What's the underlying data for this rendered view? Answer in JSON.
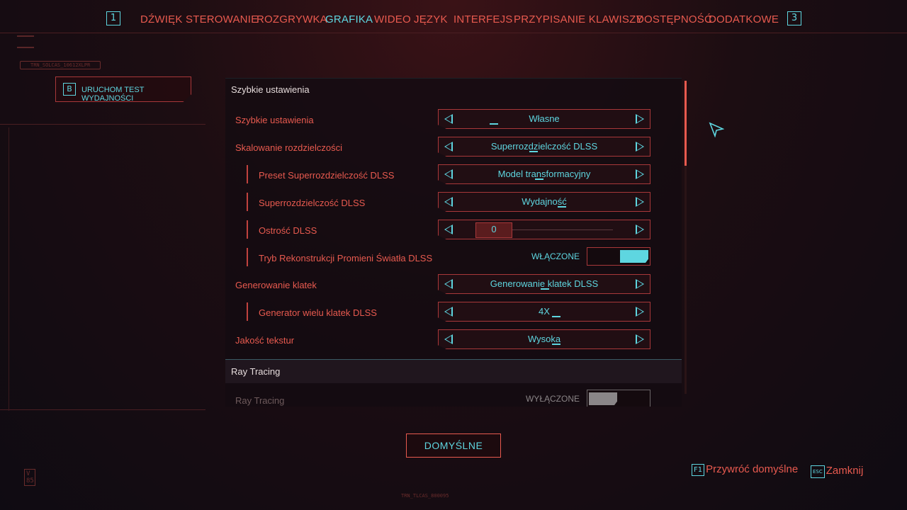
{
  "topnav": {
    "left_bumper": "1",
    "right_bumper": "3",
    "tabs": [
      {
        "label": "DŹWIĘK",
        "active": false
      },
      {
        "label": "STEROWANIE",
        "active": false
      },
      {
        "label": "ROZGRYWKA",
        "active": false
      },
      {
        "label": "GRAFIKA",
        "active": true
      },
      {
        "label": "WIDEO",
        "active": false
      },
      {
        "label": "JĘZYK",
        "active": false
      },
      {
        "label": "INTERFEJS",
        "active": false
      },
      {
        "label": "PRZYPISANIE KLAWISZY",
        "active": false
      },
      {
        "label": "DOSTĘPNOŚĆ",
        "active": false
      },
      {
        "label": "DODATKOWE",
        "active": false
      }
    ]
  },
  "benchmark": {
    "key": "B",
    "label": "URUCHOM TEST WYDAJNOŚCI"
  },
  "sections": {
    "quick": {
      "title": "Szybkie ustawienia"
    },
    "raytracing": {
      "title": "Ray Tracing"
    }
  },
  "settings": {
    "quick_preset": {
      "label": "Szybkie ustawienia",
      "value": "Własne"
    },
    "resolution_scaling": {
      "label": "Skalowanie rozdzielczości",
      "value": "Superrozdzielczość DLSS"
    },
    "dlss_preset": {
      "label": "Preset Superrozdzielczość DLSS",
      "value": "Model transformacyjny"
    },
    "dlss_quality": {
      "label": "Superrozdzielczość DLSS",
      "value": "Wydajność"
    },
    "dlss_sharpness": {
      "label": "Ostrość DLSS",
      "value": "0"
    },
    "ray_reconstruction": {
      "label": "Tryb Rekonstrukcji Promieni Światła DLSS",
      "state": "WŁĄCZONE",
      "on": true
    },
    "frame_generation": {
      "label": "Generowanie klatek",
      "value": "Generowanie klatek DLSS"
    },
    "multi_frame": {
      "label": "Generator wielu klatek DLSS",
      "value": "4X"
    },
    "texture_quality": {
      "label": "Jakość tekstur",
      "value": "Wysoka"
    },
    "ray_tracing": {
      "label": "Ray Tracing",
      "state": "WYŁĄCZONE",
      "on": false
    }
  },
  "footer": {
    "defaults_label": "DOMYŚLNE",
    "restore_key": "F1",
    "restore_label": "Przywróć domyślne",
    "close_key": "ESC",
    "close_label": "Zamknij"
  },
  "deco": {
    "tag_left": "TRN_SOLCAS_10612XLPR",
    "tag_bottom": "TRN_TLCAS_800095",
    "logo_corner": "V 85"
  },
  "colors": {
    "accent_cyan": "#5ed6e0",
    "accent_red": "#e85a4f",
    "background": "#1c0d12"
  }
}
